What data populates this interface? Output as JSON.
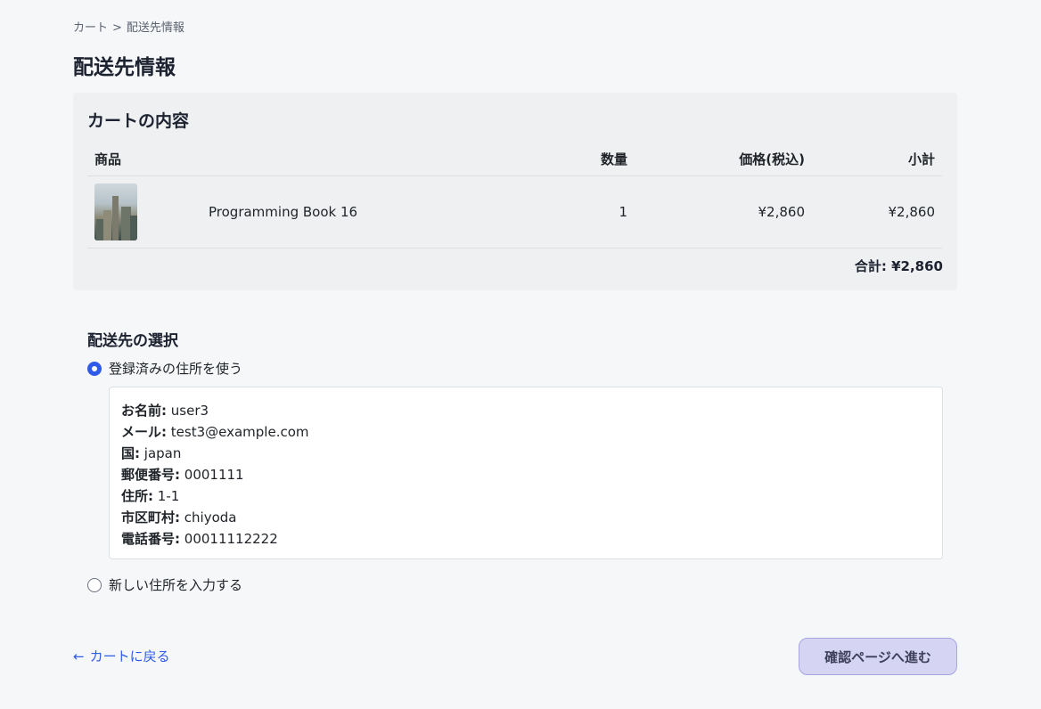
{
  "breadcrumb": {
    "cart": "カート",
    "separator": ">",
    "current": "配送先情報"
  },
  "page_title": "配送先情報",
  "cart": {
    "title": "カートの内容",
    "columns": {
      "product": "商品",
      "quantity": "数量",
      "price": "価格(税込)",
      "subtotal": "小計"
    },
    "items": [
      {
        "name": "Programming Book 16",
        "quantity": "1",
        "price": "¥2,860",
        "subtotal": "¥2,860"
      }
    ],
    "total": "合計: ¥2,860"
  },
  "shipping": {
    "title": "配送先の選択",
    "option_saved": "登録済みの住所を使う",
    "option_new": "新しい住所を入力する",
    "selected": "saved",
    "address": {
      "name_label": "お名前:",
      "name": "user3",
      "email_label": "メール:",
      "email": "test3@example.com",
      "country_label": "国:",
      "country": "japan",
      "postal_label": "郵便番号:",
      "postal": "0001111",
      "street_label": "住所:",
      "street": "1-1",
      "city_label": "市区町村:",
      "city": "chiyoda",
      "phone_label": "電話番号:",
      "phone": "00011112222"
    }
  },
  "actions": {
    "back_arrow": "←",
    "back_label": "カートに戻る",
    "next_label": "確認ページへ進む"
  },
  "colors": {
    "accent": "#2f5bea",
    "button_bg": "#d6d4f3"
  }
}
